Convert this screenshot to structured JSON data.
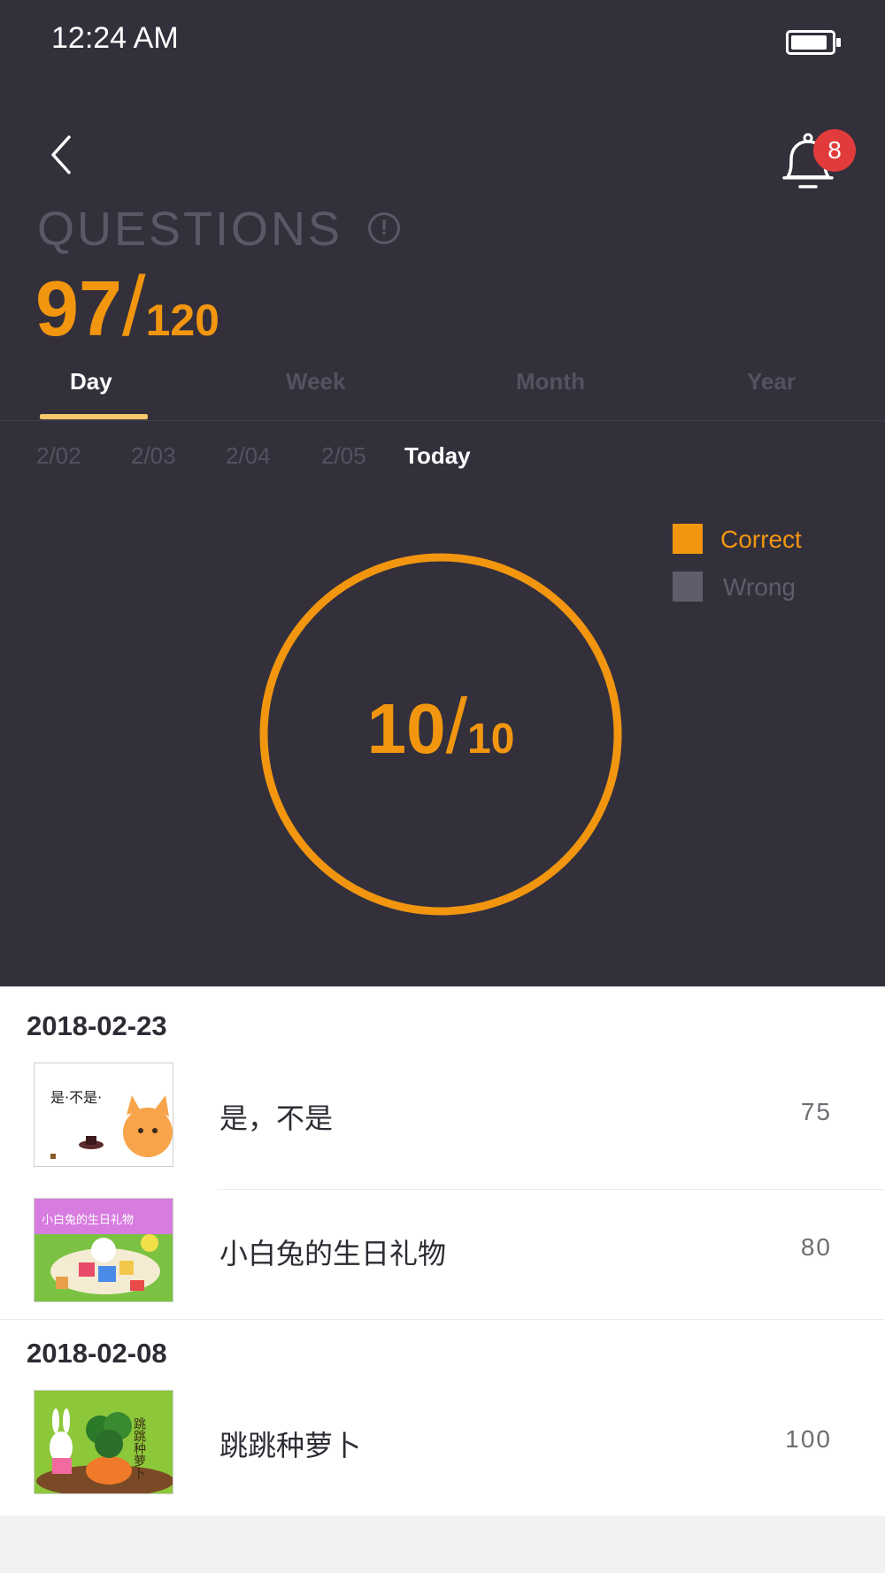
{
  "status_bar": {
    "time": "12:24 AM"
  },
  "header": {
    "notification_count": "8",
    "title": "QUESTIONS",
    "info_glyph": "!",
    "score": {
      "done": "97",
      "slash": "/",
      "total": "120"
    }
  },
  "tabs": [
    {
      "label": "Day",
      "active": true
    },
    {
      "label": "Week",
      "active": false
    },
    {
      "label": "Month",
      "active": false
    },
    {
      "label": "Year",
      "active": false
    }
  ],
  "dates": [
    {
      "label": "2/02"
    },
    {
      "label": "2/03"
    },
    {
      "label": "2/04"
    },
    {
      "label": "2/05"
    },
    {
      "label": "Today",
      "active": true
    }
  ],
  "legend": [
    {
      "label": "Correct",
      "color": "#f2960f"
    },
    {
      "label": "Wrong",
      "color": "#5f5d6a"
    }
  ],
  "chart_data": {
    "type": "pie",
    "categories": [
      "Correct",
      "Wrong"
    ],
    "values": [
      10,
      0
    ],
    "center_label": {
      "value": "10",
      "slash": "/",
      "total": "10"
    }
  },
  "history": [
    {
      "date": "2018-02-23",
      "items": [
        {
          "title": "是，不是",
          "score": "75",
          "thumb_text": "是·不是·"
        },
        {
          "title": "小白兔的生日礼物",
          "score": "80",
          "thumb_text": "小白兔的生日礼物"
        }
      ]
    },
    {
      "date": "2018-02-08",
      "items": [
        {
          "title": "跳跳种萝卜",
          "score": "100",
          "thumb_text": "跳跳种萝卜"
        }
      ]
    }
  ],
  "icons": {
    "back": "chevron-left-icon",
    "bell": "bell-icon",
    "battery": "battery-icon",
    "info": "info-circle-icon"
  },
  "colors": {
    "background_dark": "#33303c",
    "accent": "#f2960f",
    "tab_indicator": "#f5c86a",
    "badge": "#e23b3b"
  }
}
